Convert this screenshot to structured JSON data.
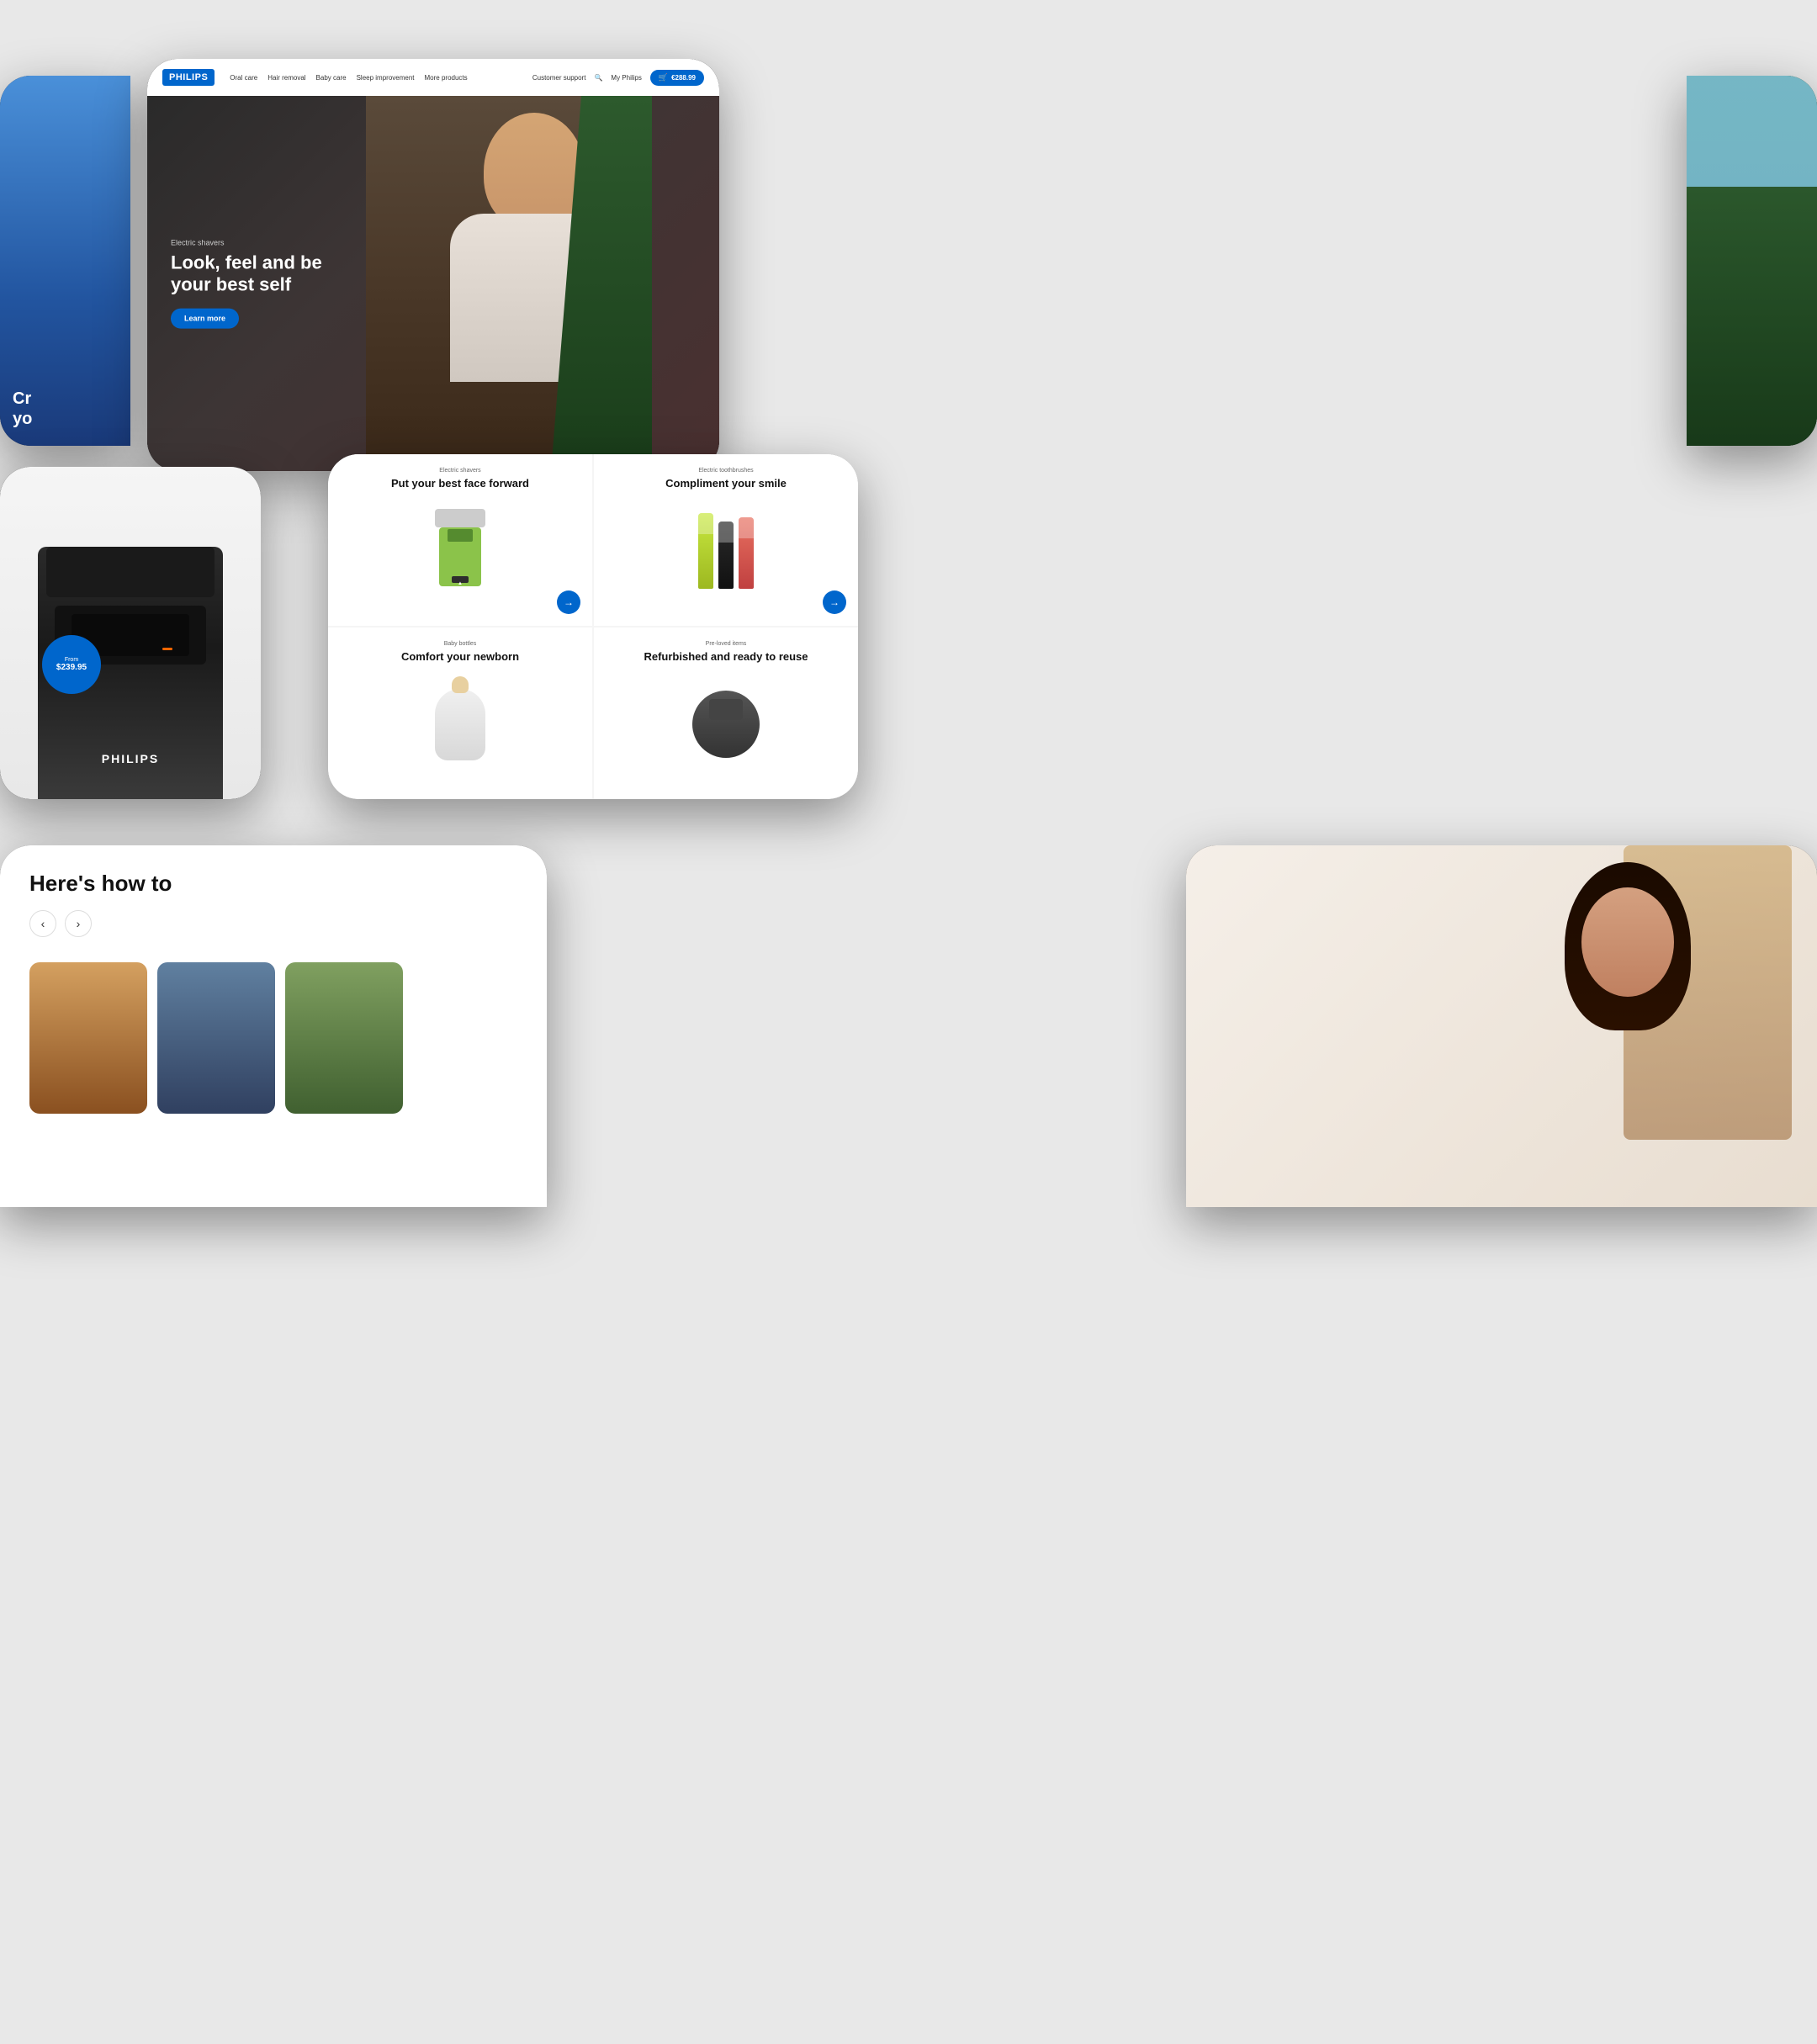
{
  "brand": {
    "name": "PHILIPS",
    "logo_bg": "#0066cc"
  },
  "nav": {
    "links": [
      "Oral care",
      "Hair removal",
      "Baby care",
      "Sleep improvement",
      "More products"
    ],
    "customer_support": "Customer support",
    "my_philips": "My Philips",
    "cart_amount": "€288.99"
  },
  "hero": {
    "eyebrow": "Electric shavers",
    "title": "Look, feel and be your best self",
    "cta": "Learn more"
  },
  "coffee_machine": {
    "price_label": "From",
    "price": "$239.95",
    "brand_label": "PHILIPS"
  },
  "product_grid": {
    "cards": [
      {
        "eyebrow": "Electric shavers",
        "title": "Put your best face forward",
        "has_arrow": true
      },
      {
        "eyebrow": "Electric toothbrushes",
        "title": "Compliment your smile",
        "has_arrow": true
      },
      {
        "eyebrow": "Baby bottles",
        "title": "Comfort your newborn",
        "has_arrow": false
      },
      {
        "eyebrow": "Pre-loved items",
        "title": "Refurbished and ready to reuse",
        "has_arrow": false
      }
    ]
  },
  "howto": {
    "title": "Here's how to",
    "nav_prev": "‹",
    "nav_next": "›"
  },
  "left_phone": {
    "promo_line1": "Cr",
    "promo_line2": "yo"
  },
  "colors": {
    "philips_blue": "#0066cc",
    "dark_bg": "#1a1a1a",
    "light_bg": "#f5f5f5",
    "text_dark": "#111111",
    "text_muted": "#666666"
  }
}
